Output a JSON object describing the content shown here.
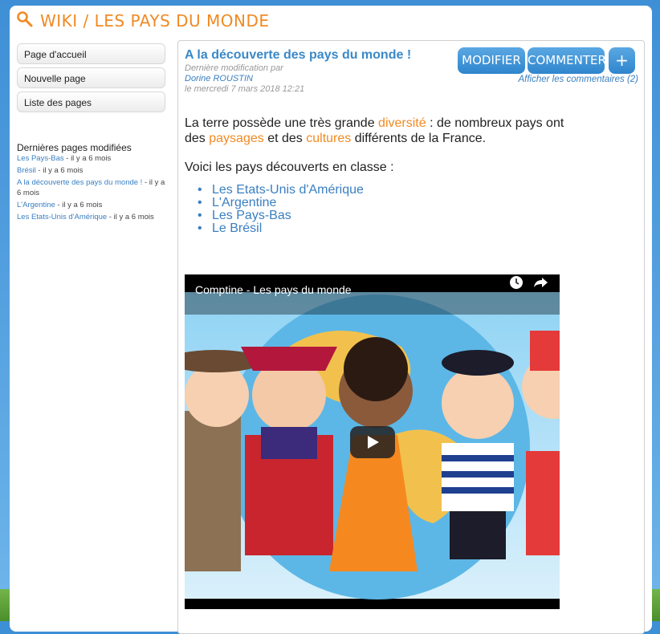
{
  "site": {
    "title": "WIKI / LES PAYS DU MONDE"
  },
  "sidebar": {
    "buttons": [
      {
        "label": "Page d'accueil"
      },
      {
        "label": "Nouvelle page"
      },
      {
        "label": "Liste des pages"
      }
    ],
    "recent_title": "Dernières pages modifiées",
    "recent": [
      {
        "link": "Les Pays-Bas",
        "suffix": " - il y a 6 mois"
      },
      {
        "link": "Brésil",
        "suffix": " - il y a 6 mois"
      },
      {
        "link": "A la découverte des pays du monde !",
        "suffix": " - il y a 6 mois"
      },
      {
        "link": "L'Argentine",
        "suffix": " - il y a 6 mois"
      },
      {
        "link": "Les Etats-Unis d'Amérique",
        "suffix": " - il y a 6 mois"
      }
    ]
  },
  "page": {
    "title": "A la découverte des pays du monde !",
    "meta_label": "Dernière modification par",
    "author": "Dorine ROUSTIN",
    "date": "le mercredi 7 mars 2018 12:21",
    "buttons": {
      "modify": "MODIFIER",
      "comment": "COMMENTER",
      "add": "+"
    },
    "comments_link": "Afficher les commentaires (2)",
    "intro": {
      "t1": "La terre possède une très grande ",
      "w1": "diversité",
      "t2": " : de nombreux pays ont",
      "t3": "des ",
      "w2": "paysages",
      "t4": " et des ",
      "w3": "cultures",
      "t5": " différents de la France."
    },
    "list_intro": "Voici les pays découverts en classe :",
    "countries": [
      "Les Etats-Unis d'Amérique",
      "L'Argentine",
      "Les Pays-Bas",
      "Le Brésil"
    ],
    "video": {
      "title": "Comptine - Les pays du monde"
    }
  },
  "colors": {
    "accent": "#f08a24",
    "link": "#3a7fc1",
    "button": "#3a89c9"
  }
}
